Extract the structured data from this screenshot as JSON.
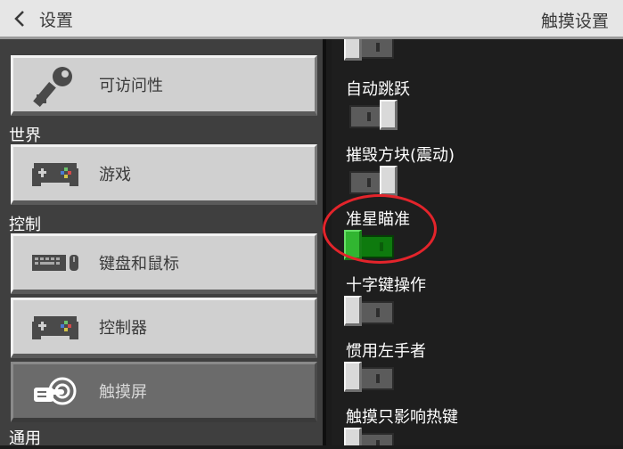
{
  "header": {
    "back_label": "设置",
    "title": "触摸设置"
  },
  "left": {
    "sections": {
      "world": "世界",
      "control": "控制",
      "general": "通用"
    },
    "items": [
      {
        "label": "可访问性",
        "icon": "key-icon"
      },
      {
        "label": "游戏",
        "icon": "gamepad-icon"
      },
      {
        "label": "键盘和鼠标",
        "icon": "keyboard-mouse-icon"
      },
      {
        "label": "控制器",
        "icon": "controller-icon"
      },
      {
        "label": "触摸屏",
        "icon": "touch-hand-icon",
        "selected": true
      }
    ]
  },
  "right": {
    "settings": [
      {
        "label": "自动跳跃",
        "state": "on"
      },
      {
        "label": "摧毁方块(震动)",
        "state": "on"
      },
      {
        "label": "准星瞄准",
        "state": "on",
        "highlighted": true
      },
      {
        "label": "十字键操作",
        "state": "off"
      },
      {
        "label": "惯用左手者",
        "state": "off"
      },
      {
        "label": "触摸只影响热键",
        "state": "off"
      }
    ]
  },
  "colors": {
    "header_bg": "#e6e6e6",
    "left_bg": "#3f3f3f",
    "right_bg": "#1e1e1e",
    "button_bg": "#d0d0d0",
    "selected_bg": "#6b6b6b",
    "toggle_on_green": "#31b631",
    "annotation_red": "#e3242b"
  }
}
